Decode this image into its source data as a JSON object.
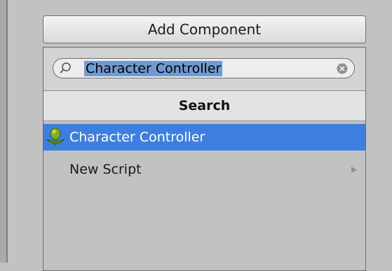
{
  "button": {
    "add_component_label": "Add Component"
  },
  "search": {
    "value": "Character Controller"
  },
  "menu": {
    "header": "Search",
    "items": [
      {
        "label": "Character Controller",
        "icon": "character-controller-icon",
        "selected": true
      },
      {
        "label": "New Script",
        "icon": "submenu-arrow-icon",
        "selected": false
      }
    ]
  },
  "colors": {
    "selection": "#3d7fe0",
    "text_highlight": "#6f9bd3",
    "panel_bg": "#c2c2c2"
  }
}
